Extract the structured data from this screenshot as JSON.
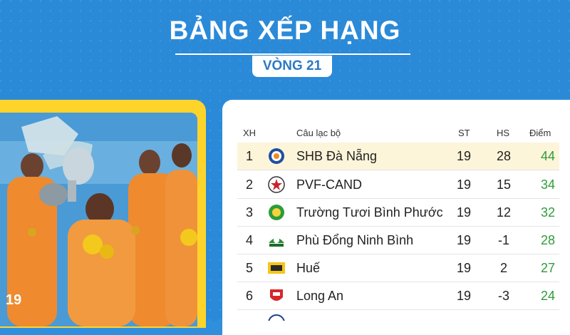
{
  "header": {
    "title": "BẢNG XẾP HẠNG",
    "round": "VÒNG 21"
  },
  "photo": {
    "jersey_number": "19"
  },
  "table": {
    "columns": {
      "rank": "XH",
      "club": "Câu lạc bộ",
      "played": "ST",
      "goal_diff": "HS",
      "points": "Điểm"
    },
    "rows": [
      {
        "rank": "1",
        "club": "SHB Đà Nẵng",
        "played": "19",
        "goal_diff": "28",
        "points": "44",
        "logo_icon": "shb-da-nang-logo-icon"
      },
      {
        "rank": "2",
        "club": "PVF-CAND",
        "played": "19",
        "goal_diff": "15",
        "points": "34",
        "logo_icon": "pvf-cand-logo-icon"
      },
      {
        "rank": "3",
        "club": "Trường Tươi Bình Phước",
        "played": "19",
        "goal_diff": "12",
        "points": "32",
        "logo_icon": "binh-phuoc-logo-icon"
      },
      {
        "rank": "4",
        "club": "Phù Đổng Ninh Bình",
        "played": "19",
        "goal_diff": "-1",
        "points": "28",
        "logo_icon": "phu-dong-logo-icon"
      },
      {
        "rank": "5",
        "club": "Huế",
        "played": "19",
        "goal_diff": "2",
        "points": "27",
        "logo_icon": "hue-logo-icon"
      },
      {
        "rank": "6",
        "club": "Long An",
        "played": "19",
        "goal_diff": "-3",
        "points": "24",
        "logo_icon": "long-an-logo-icon"
      }
    ]
  },
  "colors": {
    "background": "#2b8ad8",
    "accent_yellow": "#ffd42a",
    "points_green": "#2e9c3a",
    "highlight_row": "#fdf5d9"
  }
}
